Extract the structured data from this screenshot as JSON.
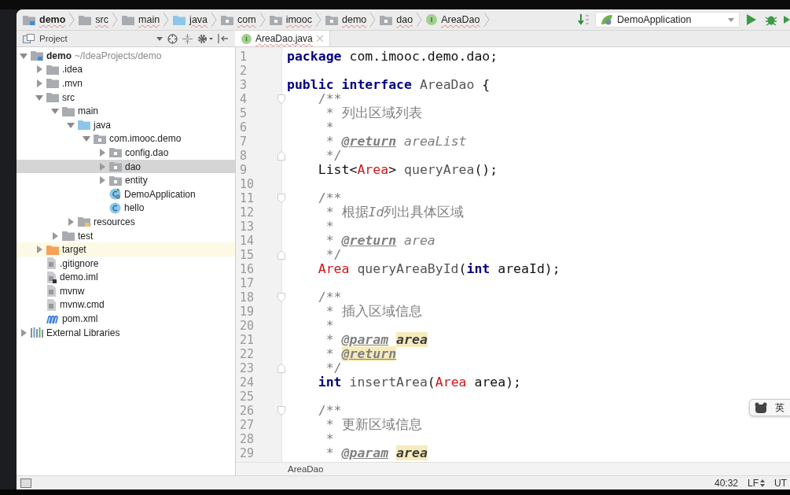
{
  "breadcrumbs": [
    {
      "label": "demo",
      "kind": "module",
      "bold": true
    },
    {
      "label": "src",
      "kind": "folder",
      "bold": false
    },
    {
      "label": "main",
      "kind": "folder",
      "bold": false
    },
    {
      "label": "java",
      "kind": "source-folder",
      "bold": false
    },
    {
      "label": "com",
      "kind": "package",
      "bold": false
    },
    {
      "label": "imooc",
      "kind": "package",
      "bold": false
    },
    {
      "label": "demo",
      "kind": "package",
      "bold": false
    },
    {
      "label": "dao",
      "kind": "package",
      "bold": false
    },
    {
      "label": "AreaDao",
      "kind": "interface",
      "bold": false
    }
  ],
  "run_config": {
    "label": "DemoApplication"
  },
  "project_panel": {
    "title": "Project"
  },
  "tabs": [
    {
      "label": "AreaDao.java",
      "selected": true
    }
  ],
  "tree": [
    {
      "label": "demo",
      "path": "~/IdeaProjects/demo",
      "kind": "module",
      "expanded": true,
      "selected": false,
      "highlighted": false,
      "children": [
        {
          "label": ".idea",
          "kind": "folder",
          "expanded": false,
          "selected": false,
          "highlighted": false
        },
        {
          "label": ".mvn",
          "kind": "folder",
          "expanded": false,
          "selected": false,
          "highlighted": false
        },
        {
          "label": "src",
          "kind": "folder",
          "expanded": true,
          "selected": false,
          "highlighted": false,
          "children": [
            {
              "label": "main",
              "kind": "folder",
              "expanded": true,
              "selected": false,
              "highlighted": false,
              "children": [
                {
                  "label": "java",
                  "kind": "source-folder",
                  "expanded": true,
                  "selected": false,
                  "highlighted": false,
                  "children": [
                    {
                      "label": "com.imooc.demo",
                      "kind": "package",
                      "expanded": true,
                      "selected": false,
                      "highlighted": false,
                      "children": [
                        {
                          "label": "config.dao",
                          "kind": "package",
                          "expanded": false,
                          "selected": false,
                          "highlighted": false
                        },
                        {
                          "label": "dao",
                          "kind": "package",
                          "expanded": false,
                          "selected": true,
                          "highlighted": false
                        },
                        {
                          "label": "entity",
                          "kind": "package",
                          "expanded": false,
                          "selected": false,
                          "highlighted": false
                        },
                        {
                          "label": "DemoApplication",
                          "kind": "spring-class",
                          "selected": false,
                          "highlighted": false
                        },
                        {
                          "label": "hello",
                          "kind": "class",
                          "selected": false,
                          "highlighted": false
                        }
                      ]
                    }
                  ]
                },
                {
                  "label": "resources",
                  "kind": "resources-folder",
                  "expanded": false,
                  "selected": false,
                  "highlighted": false
                }
              ]
            },
            {
              "label": "test",
              "kind": "folder",
              "expanded": false,
              "selected": false,
              "highlighted": false
            }
          ]
        },
        {
          "label": "target",
          "kind": "excluded-folder",
          "expanded": false,
          "selected": false,
          "highlighted": true
        },
        {
          "label": ".gitignore",
          "kind": "file",
          "selected": false,
          "highlighted": false
        },
        {
          "label": "demo.iml",
          "kind": "iml",
          "selected": false,
          "highlighted": false
        },
        {
          "label": "mvnw",
          "kind": "file",
          "selected": false,
          "highlighted": false
        },
        {
          "label": "mvnw.cmd",
          "kind": "file",
          "selected": false,
          "highlighted": false
        },
        {
          "label": "pom.xml",
          "kind": "maven",
          "selected": false,
          "highlighted": false
        }
      ]
    },
    {
      "label": "External Libraries",
      "kind": "libraries",
      "expanded": false,
      "selected": false,
      "highlighted": false
    }
  ],
  "code": [
    {
      "number": "1",
      "tokens": [
        {
          "kind": "keyword",
          "text": "package"
        },
        {
          "kind": "plain",
          "text": " com.imooc.demo.dao;"
        }
      ]
    },
    {
      "number": "2"
    },
    {
      "number": "3",
      "tokens": [
        {
          "kind": "keyword",
          "text": "public interface"
        },
        {
          "kind": "ident",
          "text": " AreaDao"
        },
        {
          "kind": "plain",
          "text": " {"
        }
      ]
    },
    {
      "number": "4",
      "fold_start": true,
      "tokens": [
        {
          "kind": "comment",
          "text": "    /**"
        }
      ]
    },
    {
      "number": "5",
      "tokens": [
        {
          "kind": "comment",
          "text": "     * 列出区域列表"
        }
      ]
    },
    {
      "number": "6",
      "tokens": [
        {
          "kind": "comment",
          "text": "     *"
        }
      ]
    },
    {
      "number": "7",
      "tokens": [
        {
          "kind": "comment",
          "text": "     * "
        },
        {
          "kind": "doctag",
          "text": "@return"
        },
        {
          "kind": "docvalue",
          "text": " areaList"
        }
      ]
    },
    {
      "number": "8",
      "fold_end": true,
      "tokens": [
        {
          "kind": "comment",
          "text": "     */"
        }
      ]
    },
    {
      "number": "9",
      "tokens": [
        {
          "kind": "plain",
          "text": "    List<"
        },
        {
          "kind": "type",
          "text": "Area"
        },
        {
          "kind": "plain",
          "text": "> "
        },
        {
          "kind": "ident",
          "text": "queryArea"
        },
        {
          "kind": "plain",
          "text": "();"
        }
      ]
    },
    {
      "number": "10"
    },
    {
      "number": "11",
      "fold_start": true,
      "tokens": [
        {
          "kind": "comment",
          "text": "    /**"
        }
      ]
    },
    {
      "number": "12",
      "tokens": [
        {
          "kind": "comment",
          "text": "     * 根据"
        },
        {
          "kind": "docvalue",
          "text": "Id"
        },
        {
          "kind": "comment",
          "text": "列出具体区域"
        }
      ]
    },
    {
      "number": "13",
      "tokens": [
        {
          "kind": "comment",
          "text": "     *"
        }
      ]
    },
    {
      "number": "14",
      "tokens": [
        {
          "kind": "comment",
          "text": "     * "
        },
        {
          "kind": "doctag",
          "text": "@return"
        },
        {
          "kind": "docvalue",
          "text": " area"
        }
      ]
    },
    {
      "number": "15",
      "fold_end": true,
      "tokens": [
        {
          "kind": "comment",
          "text": "     */"
        }
      ]
    },
    {
      "number": "16",
      "tokens": [
        {
          "kind": "type",
          "text": "    Area"
        },
        {
          "kind": "ident",
          "text": " queryAreaById"
        },
        {
          "kind": "plain",
          "text": "("
        },
        {
          "kind": "keyword",
          "text": "int"
        },
        {
          "kind": "plain",
          "text": " areaId);"
        }
      ]
    },
    {
      "number": "17"
    },
    {
      "number": "18",
      "fold_start": true,
      "tokens": [
        {
          "kind": "comment",
          "text": "    /**"
        }
      ]
    },
    {
      "number": "19",
      "tokens": [
        {
          "kind": "comment",
          "text": "     * 插入区域信息"
        }
      ]
    },
    {
      "number": "20",
      "tokens": [
        {
          "kind": "comment",
          "text": "     *"
        }
      ]
    },
    {
      "number": "21",
      "tokens": [
        {
          "kind": "comment",
          "text": "     * "
        },
        {
          "kind": "doctag",
          "text": "@param"
        },
        {
          "kind": "docparam",
          "text": "area"
        }
      ]
    },
    {
      "number": "22",
      "tokens": [
        {
          "kind": "comment",
          "text": "     * "
        },
        {
          "kind": "doctag-warn",
          "text": "@return"
        }
      ]
    },
    {
      "number": "23",
      "fold_end": true,
      "tokens": [
        {
          "kind": "comment",
          "text": "     */"
        }
      ]
    },
    {
      "number": "24",
      "tokens": [
        {
          "kind": "keyword",
          "text": "    int"
        },
        {
          "kind": "ident",
          "text": " insertArea"
        },
        {
          "kind": "plain",
          "text": "("
        },
        {
          "kind": "type",
          "text": "Area"
        },
        {
          "kind": "plain",
          "text": " area);"
        }
      ]
    },
    {
      "number": "25"
    },
    {
      "number": "26",
      "fold_start": true,
      "tokens": [
        {
          "kind": "comment",
          "text": "    /**"
        }
      ]
    },
    {
      "number": "27",
      "tokens": [
        {
          "kind": "comment",
          "text": "     * 更新区域信息"
        }
      ]
    },
    {
      "number": "28",
      "tokens": [
        {
          "kind": "comment",
          "text": "     *"
        }
      ]
    },
    {
      "number": "29",
      "tokens": [
        {
          "kind": "comment",
          "text": "     * "
        },
        {
          "kind": "doctag",
          "text": "@param"
        },
        {
          "kind": "docparam",
          "text": "area"
        }
      ]
    }
  ],
  "editor_breadcrumb": "AreaDao",
  "input_method": {
    "label": "英"
  },
  "status_bar": {
    "position": "40:32",
    "line_separator": "LF",
    "encoding": "UT"
  }
}
